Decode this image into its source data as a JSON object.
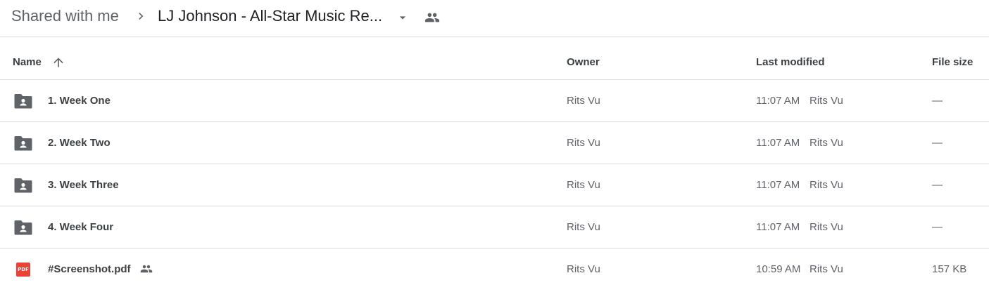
{
  "breadcrumb": {
    "root": "Shared with me",
    "current": "LJ Johnson - All-Star Music Re..."
  },
  "table": {
    "headers": {
      "name": "Name",
      "owner": "Owner",
      "last_modified": "Last modified",
      "file_size": "File size"
    },
    "sort": {
      "column": "name",
      "direction": "ascending"
    },
    "rows": [
      {
        "name": "1. Week One",
        "type": "shared-folder",
        "owner": "Rits Vu",
        "modified_time": "11:07 AM",
        "modified_by": "Rits Vu",
        "size": "—"
      },
      {
        "name": "2. Week Two",
        "type": "shared-folder",
        "owner": "Rits Vu",
        "modified_time": "11:07 AM",
        "modified_by": "Rits Vu",
        "size": "—"
      },
      {
        "name": "3. Week Three",
        "type": "shared-folder",
        "owner": "Rits Vu",
        "modified_time": "11:07 AM",
        "modified_by": "Rits Vu",
        "size": "—"
      },
      {
        "name": "4. Week Four",
        "type": "shared-folder",
        "owner": "Rits Vu",
        "modified_time": "11:07 AM",
        "modified_by": "Rits Vu",
        "size": "—"
      },
      {
        "name": "#Screenshot.pdf",
        "type": "pdf",
        "pdf_badge": "PDF",
        "shared": true,
        "owner": "Rits Vu",
        "modified_time": "10:59 AM",
        "modified_by": "Rits Vu",
        "size": "157 KB"
      }
    ]
  },
  "colors": {
    "text_primary": "#202124",
    "text_secondary": "#5f6368",
    "divider": "#dadce0",
    "folder_icon": "#5f6368",
    "pdf_icon": "#ea4335"
  },
  "icons": {
    "chevron": "chevron-right-icon",
    "dropdown": "arrow-drop-down-icon",
    "shared": "people-icon",
    "sort": "arrow-up-icon",
    "folder": "shared-folder-icon",
    "pdf": "pdf-icon"
  }
}
